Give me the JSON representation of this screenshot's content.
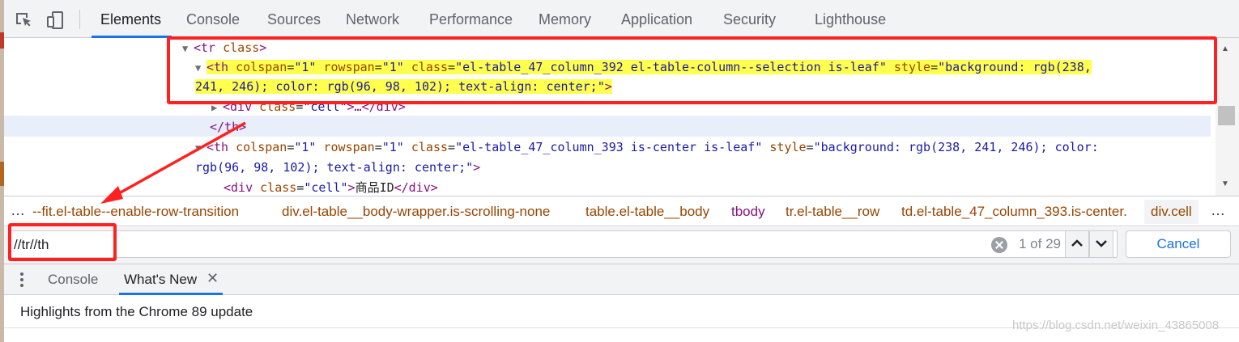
{
  "toolbar": {
    "icons": [
      "inspect-element-icon",
      "device-toolbar-icon"
    ],
    "tabs": [
      "Elements",
      "Console",
      "Sources",
      "Network",
      "Performance",
      "Memory",
      "Application",
      "Security",
      "Lighthouse"
    ],
    "active_tab": "Elements"
  },
  "elements": {
    "line0": {
      "tag_open": "<tr ",
      "attr": "class",
      "close": ">"
    },
    "line1": {
      "tag_open": "<th ",
      "a1": "colspan",
      "v1": "\"1\"",
      "a2": "rowspan",
      "v2": "\"1\"",
      "a3": "class",
      "v3": "\"el-table_47_column_392   el-table-column--selection  is-leaf\"",
      "a4": "style",
      "v4a": "\"background: rgb(238,",
      "v4b": "241, 246); color: rgb(96, 98, 102); text-align: center;\"",
      "close": ">"
    },
    "line3": {
      "tag_open": "<div ",
      "attr": "class",
      "value": "\"cell\"",
      "mid": ">…</div>"
    },
    "line4": {
      "text": "</th>"
    },
    "line5": {
      "tag_open": "<th ",
      "a1": "colspan",
      "v1": "\"1\"",
      "a2": "rowspan",
      "v2": "\"1\"",
      "a3": "class",
      "v3": "\"el-table_47_column_393  is-center   is-leaf\"",
      "a4": "style",
      "v4a": "\"background: rgb(238, 241, 246); color:",
      "v4b": "rgb(96, 98, 102); text-align: center;\"",
      "close": ">"
    },
    "line7": {
      "tag_open": "<div ",
      "attr": "class",
      "value": "\"cell\"",
      "close": ">",
      "text": "商品ID",
      "end": "</div>"
    }
  },
  "breadcrumbs": {
    "ellipsis_left": "…",
    "items": [
      "--fit.el-table--enable-row-transition",
      "div.el-table__body-wrapper.is-scrolling-none",
      "table.el-table__body",
      "tbody",
      "tr.el-table__row",
      "td.el-table_47_column_393.is-center.",
      "div.cell"
    ],
    "ellipsis_right": "…"
  },
  "search": {
    "value": "//tr//th",
    "match_count": "1 of 29",
    "cancel_label": "Cancel",
    "prev_glyph": "⌃",
    "next_glyph": "⌄"
  },
  "drawer": {
    "tabs": [
      "Console",
      "What's New"
    ],
    "active_tab": "What's New",
    "close_glyph": "✕",
    "highlights": "Highlights from the Chrome 89 update"
  },
  "watermark": "https://blog.csdn.net/weixin_43865008",
  "colors": {
    "annotation_red": "#ff2020",
    "highlight_yellow": "#ffff4d",
    "accent_blue": "#1a73e8",
    "tag_purple": "#881280",
    "attr_brown": "#994500",
    "value_blue": "#1a1aa6"
  }
}
